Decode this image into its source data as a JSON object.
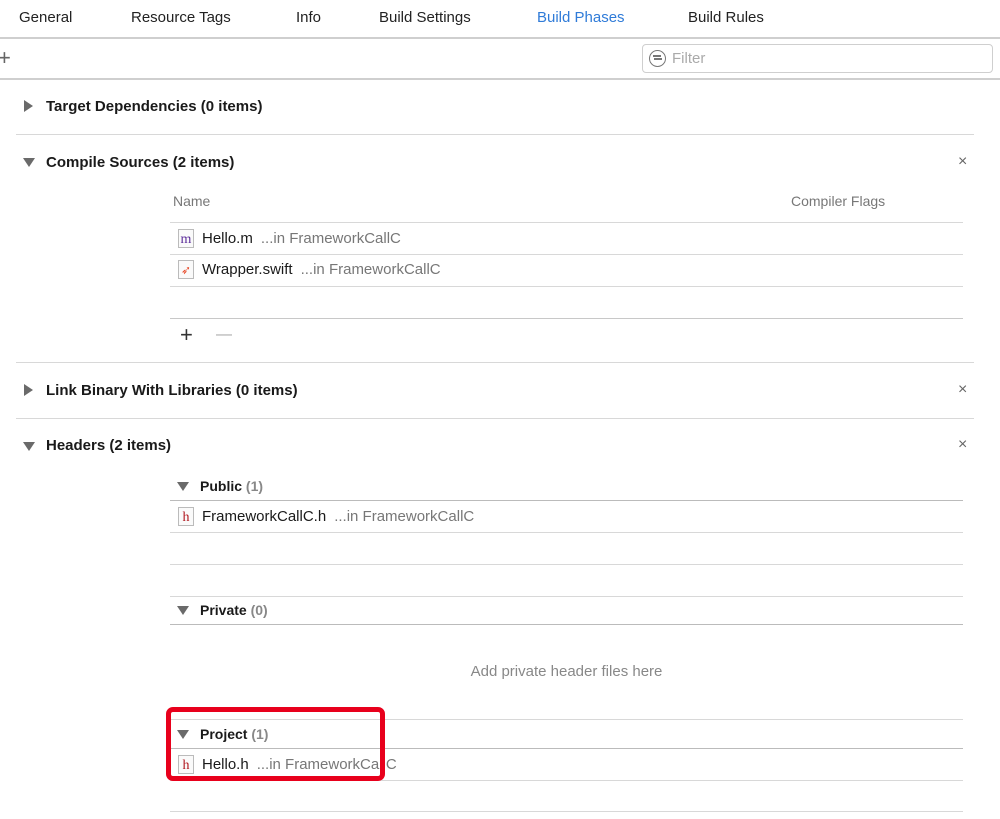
{
  "tabs": [
    {
      "label": "General"
    },
    {
      "label": "Resource Tags"
    },
    {
      "label": "Info"
    },
    {
      "label": "Build Settings"
    },
    {
      "label": "Build Phases",
      "active": true
    },
    {
      "label": "Build Rules"
    }
  ],
  "toolbar": {
    "add": "+",
    "filter_placeholder": "Filter"
  },
  "sections": {
    "target_deps": {
      "title": "Target Dependencies (0 items)"
    },
    "compile": {
      "title": "Compile Sources (2 items)",
      "col_name": "Name",
      "col_flags": "Compiler Flags",
      "files": [
        {
          "name": "Hello.m",
          "loc": "...in FrameworkCallC",
          "icon": "m"
        },
        {
          "name": "Wrapper.swift",
          "loc": "...in FrameworkCallC",
          "icon": "swift"
        }
      ],
      "add": "+",
      "remove": "—"
    },
    "link": {
      "title": "Link Binary With Libraries (0 items)"
    },
    "headers": {
      "title": "Headers (2 items)",
      "public": {
        "label": "Public",
        "count": "(1)",
        "files": [
          {
            "name": "FrameworkCallC.h",
            "loc": "...in FrameworkCallC",
            "icon": "h"
          }
        ]
      },
      "private": {
        "label": "Private",
        "count": "(0)",
        "placeholder": "Add private header files here"
      },
      "project": {
        "label": "Project",
        "count": "(1)",
        "files": [
          {
            "name": "Hello.h",
            "loc": "...in FrameworkCallC",
            "icon": "h"
          }
        ]
      }
    }
  },
  "close_glyph": "×",
  "colors": {
    "accent": "#2f7bd8",
    "highlight": "#e8001c"
  }
}
